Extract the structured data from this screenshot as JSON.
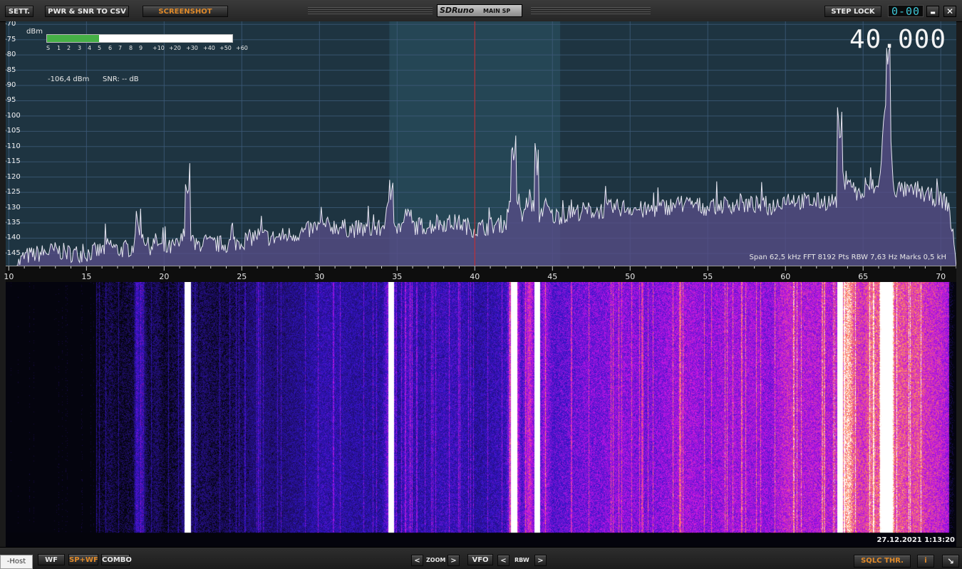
{
  "toolbar": {
    "sett_label": "SETT.",
    "pwr_snr_label": "PWR & SNR TO CSV",
    "screenshot_label": "SCREENSHOT",
    "app_logo": "SDRuno",
    "window_name": "MAIN SP",
    "step_lock_label": "STEP LOCK",
    "lcd_value": "0-00",
    "minimize_symbol": "▬",
    "close_symbol": "✕"
  },
  "spectrum": {
    "frequency_display": "40.000",
    "dbm_unit": "dBm",
    "meter_level_fraction": 0.28,
    "s_meter_scale": [
      "S",
      "1",
      "2",
      "3",
      "4",
      "5",
      "6",
      "7",
      "8",
      "9",
      "+10",
      "+20",
      "+30",
      "+40",
      "+50",
      "+60"
    ],
    "level_readout": "-106,4 dBm",
    "snr_readout": "SNR: -- dB",
    "y_ticks": [
      "-70",
      "-75",
      "-80",
      "-85",
      "-90",
      "-95",
      "-100",
      "-105",
      "-110",
      "-115",
      "-120",
      "-125",
      "-130",
      "-135",
      "-140",
      "-145"
    ],
    "x_ticks": [
      "10",
      "15",
      "20",
      "25",
      "30",
      "35",
      "40",
      "45",
      "50",
      "55",
      "60",
      "65",
      "70"
    ],
    "info_line": "Span 62,5 kHz  FFT 8192 Pts  RBW 7,63 Hz  Marks 0,5 kH",
    "colors": {
      "background": "#1e3441",
      "passband": "#2b5666",
      "grid": "#3e5b7a",
      "trace": "#e6e6f0",
      "fill": "#5a4d8a",
      "vfo_line": "#d02a2a"
    }
  },
  "chart_data": {
    "type": "line",
    "title": "",
    "xlabel": "",
    "ylabel": "dBm",
    "xlim": [
      9.8,
      71.0
    ],
    "ylim": [
      -149,
      -69
    ],
    "grid": true,
    "x": [
      10.5,
      11,
      12,
      13,
      14,
      15,
      16,
      16.5,
      17,
      18,
      18.2,
      19,
      19.5,
      20,
      21,
      21.5,
      22,
      22.5,
      23,
      24,
      25,
      26,
      27,
      28,
      29,
      30,
      31,
      32,
      33,
      34,
      34.6,
      35,
      35.9,
      36,
      37,
      38,
      39,
      40,
      41,
      42,
      42.5,
      43,
      43.5,
      44,
      44.5,
      45,
      46,
      47,
      48,
      49,
      50,
      51,
      52,
      53,
      54,
      55,
      56,
      57,
      58,
      59,
      60,
      60.5,
      61,
      62,
      63,
      63.5,
      64,
      64.5,
      65,
      65.5,
      66,
      66.5,
      67,
      67.5,
      68,
      68.5,
      69,
      70,
      70.5,
      71
    ],
    "values": [
      -149,
      -146,
      -145,
      -144,
      -145,
      -145,
      -144,
      -142,
      -144,
      -143,
      -134,
      -143,
      -141,
      -144,
      -142,
      -136,
      -143,
      -141,
      -142,
      -142,
      -141,
      -139,
      -140,
      -139,
      -138,
      -136,
      -136,
      -137,
      -137,
      -137,
      -128,
      -137,
      -133,
      -136,
      -136,
      -135,
      -135,
      -137,
      -136,
      -135,
      -121,
      -134,
      -126,
      -134,
      -129,
      -133,
      -132,
      -131,
      -131,
      -130,
      -130,
      -131,
      -130,
      -129,
      -129,
      -130,
      -129,
      -129,
      -129,
      -130,
      -127,
      -127,
      -128,
      -128,
      -128,
      -127,
      -119,
      -125,
      -126,
      -123,
      -124,
      -91,
      -124,
      -124,
      -125,
      -124,
      -126,
      -127,
      -129,
      -148
    ],
    "peaks": [
      {
        "x": 66.6,
        "y": -84
      },
      {
        "x": 63.5,
        "y": -109
      },
      {
        "x": 42.5,
        "y": -117
      },
      {
        "x": 44.0,
        "y": -118
      },
      {
        "x": 21.5,
        "y": -127
      },
      {
        "x": 34.6,
        "y": -127
      }
    ],
    "vfo_x": 40.0
  },
  "waterfall": {
    "timestamp": "27.12.2021 1:13:20"
  },
  "bottombar": {
    "host_label": "-Host",
    "wf_label": "WF",
    "spwf_label": "SP+WF",
    "combo_label": "COMBO",
    "zoom_label": "ZOOM",
    "vfo_label": "VFO",
    "rbw_label": "RBW",
    "left_arrow": "<",
    "right_arrow": ">",
    "sqlc_label": "SQLC THR.",
    "info_label": "i",
    "resize_symbol": "↘"
  }
}
